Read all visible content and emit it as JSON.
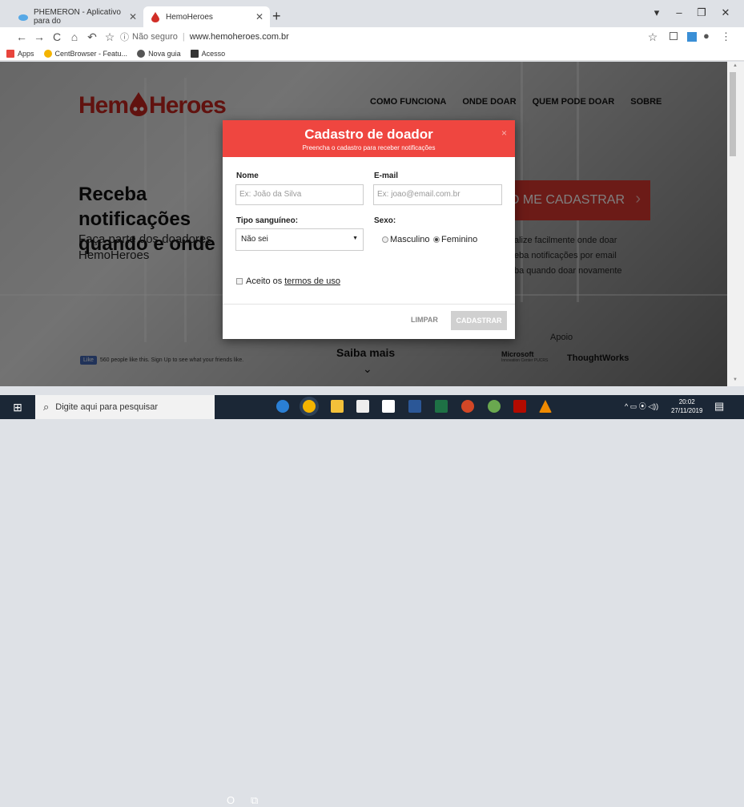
{
  "browser": {
    "tabs": [
      {
        "title": "PHEMERON - Aplicativo para do",
        "active": false
      },
      {
        "title": "HemoHeroes",
        "active": true
      }
    ],
    "new_tab": "+",
    "window_controls": {
      "minimize": "–",
      "restore": "❐",
      "close": "✕",
      "dropdown": "▾"
    },
    "nav": {
      "back": "←",
      "forward": "→",
      "reload": "C",
      "home": "⌂",
      "history": "↶",
      "bookmark": "☆"
    },
    "address": {
      "security_icon": "ⓘ",
      "security": "Não seguro",
      "url": "www.hemoheroes.com.br"
    },
    "toolbar_right": {
      "star": "☆",
      "menu": "⋮",
      "profile": "●"
    },
    "bookmarks": [
      {
        "label": "Apps",
        "color": "#e8453c"
      },
      {
        "label": "CentBrowser - Featu...",
        "color": "#f4b400"
      },
      {
        "label": "Nova guia",
        "color": "#555555"
      },
      {
        "label": "Acesso",
        "color": "#333333"
      }
    ]
  },
  "site": {
    "logo": {
      "left": "Hem",
      "right": "Heroes",
      "color": "#c2251f"
    },
    "nav": [
      "COMO FUNCIONA",
      "ONDE DOAR",
      "QUEM PODE DOAR",
      "SOBRE"
    ],
    "hero_heading": "Receba notificações quando e onde",
    "hero_text": "Faça parte dos doadores HemoHeroes",
    "cta": "O ME CADASTRAR",
    "cta_chevron": "›",
    "features": [
      "alize facilmente onde doar",
      "eba notificações por email",
      "ba quando doar novamente"
    ],
    "saiba_mais": "Saiba mais",
    "saiba_chevron": "⌄",
    "apoio": "Apoio",
    "sponsors": {
      "microsoft": "Microsoft",
      "microsoft_sub": "Innovation Center PUCRS",
      "thoughtworks": "ThoughtWorks"
    },
    "fb": {
      "like": "Like",
      "text": "560 people like this. Sign Up to see what your friends like."
    }
  },
  "modal": {
    "title": "Cadastro de doador",
    "subtitle": "Preencha o cadastro para receber notificações",
    "close": "×",
    "nome_label": "Nome",
    "nome_placeholder": "Ex: João da Silva",
    "email_label": "E-mail",
    "email_placeholder": "Ex: joao@email.com.br",
    "tipo_label": "Tipo sanguíneo:",
    "tipo_value": "Não sei",
    "tipo_arrow": "▼",
    "sexo_label": "Sexo:",
    "sexo_options": [
      {
        "label": "Masculino",
        "checked": false
      },
      {
        "label": "Feminino",
        "checked": true
      }
    ],
    "terms_prefix": "Aceito os",
    "terms_link": "termos de uso",
    "btn_clear": "LIMPAR",
    "btn_submit": "CADASTRAR"
  },
  "taskbar": {
    "start": "⊞",
    "search_icon": "⌕",
    "search_placeholder": "Digite aqui para pesquisar",
    "cortana": "O",
    "taskview": "⧉",
    "time": "20:02",
    "date": "27/11/2019",
    "tray": "^ ▭ ⦿ ◁))",
    "notifications": "▤"
  }
}
